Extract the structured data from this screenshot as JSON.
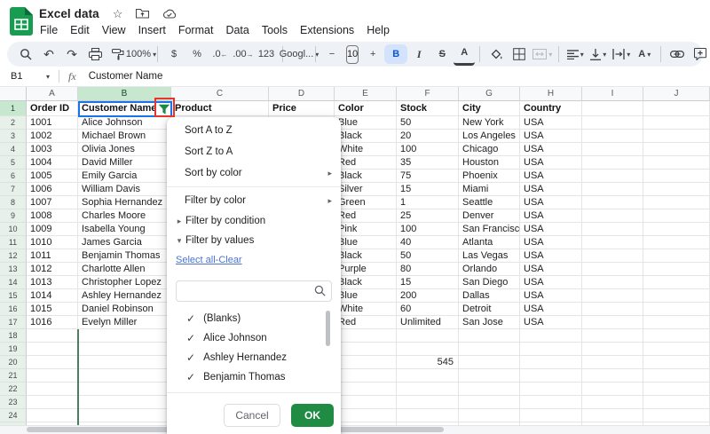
{
  "app": {
    "title": "Excel data"
  },
  "menubar": {
    "items": [
      "File",
      "Edit",
      "View",
      "Insert",
      "Format",
      "Data",
      "Tools",
      "Extensions",
      "Help"
    ]
  },
  "toolbar": {
    "zoom": "100%",
    "currency": "$",
    "percent": "%",
    "decrease_decimal": ".0",
    "increase_decimal": ".00",
    "number_format": "123",
    "font_name": "Googl...",
    "minus": "−",
    "font_size": "10",
    "plus": "+",
    "bold": "B",
    "italic": "I",
    "strikethrough": "S",
    "text_color": "A",
    "text_rotation": "A"
  },
  "formula_bar": {
    "cell_ref": "B1",
    "fx_label": "fx",
    "value": "Customer Name"
  },
  "grid": {
    "column_letters": [
      "A",
      "B",
      "C",
      "D",
      "E",
      "F",
      "G",
      "H",
      "I",
      "J"
    ],
    "selected_column": "B",
    "selected_cell": "B1",
    "header_row": [
      "Order ID",
      "Customer Name",
      "Product",
      "Price",
      "Color",
      "Stock",
      "City",
      "Country",
      "",
      ""
    ],
    "rows": [
      {
        "order_id": "1001",
        "customer": "Alice Johnson",
        "color": "Blue",
        "stock": "50",
        "city": "New York",
        "country": "USA"
      },
      {
        "order_id": "1002",
        "customer": "Michael Brown",
        "color": "Black",
        "stock": "20",
        "city": "Los Angeles",
        "country": "USA"
      },
      {
        "order_id": "1003",
        "customer": "Olivia Jones",
        "color": "White",
        "stock": "100",
        "city": "Chicago",
        "country": "USA"
      },
      {
        "order_id": "1004",
        "customer": "David Miller",
        "color": "Red",
        "stock": "35",
        "city": "Houston",
        "country": "USA"
      },
      {
        "order_id": "1005",
        "customer": "Emily Garcia",
        "color": "Black",
        "stock": "75",
        "city": "Phoenix",
        "country": "USA"
      },
      {
        "order_id": "1006",
        "customer": "William Davis",
        "color": "Silver",
        "stock": "15",
        "city": "Miami",
        "country": "USA"
      },
      {
        "order_id": "1007",
        "customer": "Sophia Hernandez",
        "color": "Green",
        "stock": "1",
        "city": "Seattle",
        "country": "USA"
      },
      {
        "order_id": "1008",
        "customer": "Charles Moore",
        "color": "Red",
        "stock": "25",
        "city": "Denver",
        "country": "USA"
      },
      {
        "order_id": "1009",
        "customer": "Isabella Young",
        "color": "Pink",
        "stock": "100",
        "city": "San Francisco",
        "country": "USA"
      },
      {
        "order_id": "1010",
        "customer": "James Garcia",
        "color": "Blue",
        "stock": "40",
        "city": "Atlanta",
        "country": "USA"
      },
      {
        "order_id": "1011",
        "customer": "Benjamin Thomas",
        "color": "Black",
        "stock": "50",
        "city": "Las Vegas",
        "country": "USA"
      },
      {
        "order_id": "1012",
        "customer": "Charlotte Allen",
        "color": "Purple",
        "stock": "80",
        "city": "Orlando",
        "country": "USA"
      },
      {
        "order_id": "1013",
        "customer": "Christopher Lopez",
        "color": "Black",
        "stock": "15",
        "city": "San Diego",
        "country": "USA"
      },
      {
        "order_id": "1014",
        "customer": "Ashley Hernandez",
        "color": "Blue",
        "stock": "200",
        "city": "Dallas",
        "country": "USA"
      },
      {
        "order_id": "1015",
        "customer": "Daniel Robinson",
        "color": "White",
        "stock": "60",
        "city": "Detroit",
        "country": "USA"
      },
      {
        "order_id": "1016",
        "customer": "Evelyn Miller",
        "color": "Red",
        "stock": "Unlimited",
        "city": "San Jose",
        "country": "USA"
      }
    ],
    "extra_cell": {
      "ref": "F20",
      "value": "545"
    },
    "visible_row_count": 25
  },
  "filter_menu": {
    "sort_az": "Sort A to Z",
    "sort_za": "Sort Z to A",
    "sort_by_color": "Sort by color",
    "filter_by_color": "Filter by color",
    "filter_by_condition": "Filter by condition",
    "filter_by_values": "Filter by values",
    "select_all": "Select all",
    "link_separator": "-",
    "clear": "Clear",
    "search_value": "",
    "values": [
      {
        "label": "(Blanks)",
        "checked": true
      },
      {
        "label": "Alice Johnson",
        "checked": true
      },
      {
        "label": "Ashley Hernandez",
        "checked": true
      },
      {
        "label": "Benjamin Thomas",
        "checked": true
      }
    ],
    "cancel_label": "Cancel",
    "ok_label": "OK"
  },
  "colors": {
    "accent_blue": "#1a73e8",
    "filter_icon_green": "#1a8a45",
    "ok_green": "#1f8b43",
    "annotation_red": "#e5352f",
    "selected_header_green": "#c8e7cf",
    "row_header_green": "#e7f1ea",
    "link_blue": "#4a73d2"
  }
}
